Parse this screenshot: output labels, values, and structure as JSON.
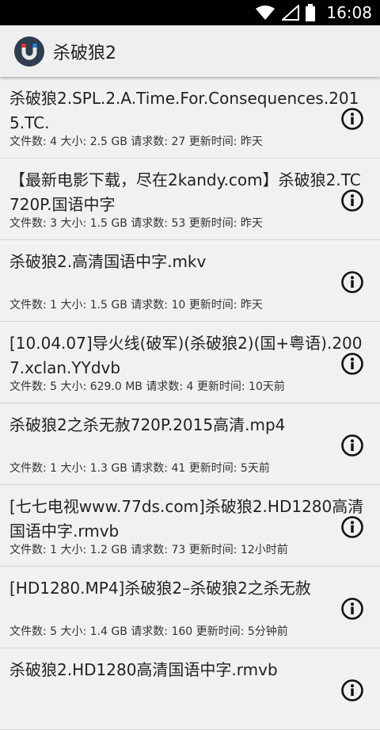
{
  "status_bar": {
    "time": "16:08",
    "icons": [
      "wifi-icon",
      "signal-icon",
      "battery-icon"
    ]
  },
  "app_bar": {
    "logo_icon": "magnet-icon",
    "title": "杀破狼2"
  },
  "results": [
    {
      "title": "杀破狼2.SPL.2.A.Time.For.Consequences.2015.TC.",
      "meta": "文件数: 4 大小: 2.5 GB 请求数: 27 更新时间: 昨天"
    },
    {
      "title": "【最新电影下载，尽在2kandy.com】杀破狼2.TC720P.国语中字",
      "meta": "文件数: 3 大小: 1.5 GB 请求数: 53 更新时间: 昨天"
    },
    {
      "title": "杀破狼2.高清国语中字.mkv",
      "meta": "文件数: 1 大小: 1.5 GB 请求数: 10 更新时间: 昨天"
    },
    {
      "title": "[10.04.07]导火线(破军)(杀破狼2)(国+粤语).2007.xclan.YYdvb",
      "meta": "文件数: 5 大小: 629.0 MB 请求数: 4 更新时间: 10天前"
    },
    {
      "title": "杀破狼2之杀无赦720P.2015高清.mp4",
      "meta": "文件数: 1 大小: 1.3 GB 请求数: 41 更新时间: 5天前"
    },
    {
      "title": "[七七电视www.77ds.com]杀破狼2.HD1280高清国语中字.rmvb",
      "meta": "文件数: 1 大小: 1.2 GB 请求数: 73 更新时间: 12小时前"
    },
    {
      "title": "[HD1280.MP4]杀破狼2–杀破狼2之杀无赦",
      "meta": "文件数: 5 大小: 1.4 GB 请求数: 160 更新时间: 5分钟前"
    },
    {
      "title": "杀破狼2.HD1280高清国语中字.rmvb",
      "meta": ""
    }
  ],
  "row_icon": "info-icon"
}
